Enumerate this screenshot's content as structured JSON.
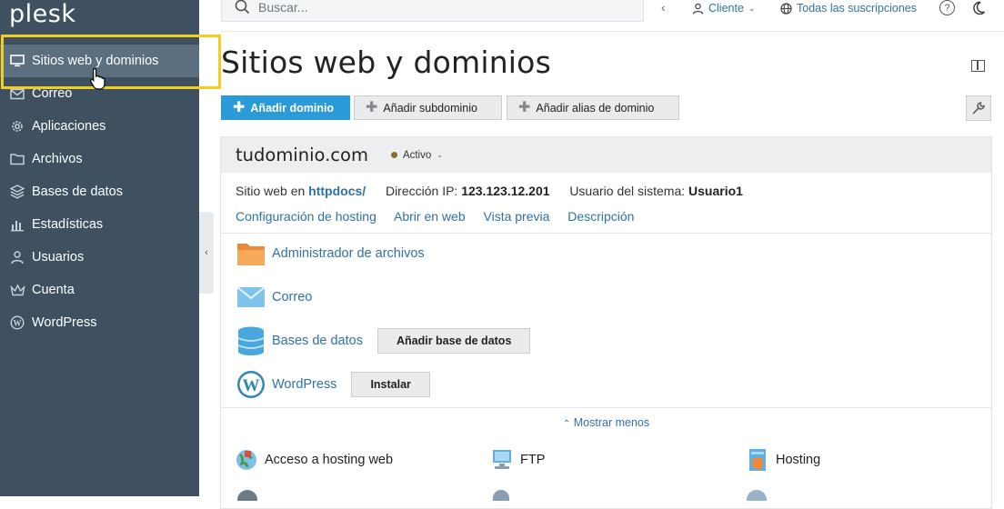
{
  "app": {
    "logo_text": "plesk"
  },
  "sidebar": {
    "items": [
      {
        "label": "Sitios web y dominios",
        "icon": "monitor-icon",
        "active": true
      },
      {
        "label": "Correo",
        "icon": "mail-icon"
      },
      {
        "label": "Aplicaciones",
        "icon": "gear-icon"
      },
      {
        "label": "Archivos",
        "icon": "folder-icon"
      },
      {
        "label": "Bases de datos",
        "icon": "database-icon"
      },
      {
        "label": "Estadísticas",
        "icon": "bar-chart-icon"
      },
      {
        "label": "Usuarios",
        "icon": "user-icon"
      },
      {
        "label": "Cuenta",
        "icon": "crown-icon"
      },
      {
        "label": "WordPress",
        "icon": "wordpress-icon"
      }
    ]
  },
  "topbar": {
    "search_placeholder": "Buscar...",
    "client_label": "Cliente",
    "subscriptions_label": "Todas las suscripciones",
    "help_glyph": "?"
  },
  "page": {
    "title": "Sitios web y dominios"
  },
  "toolbar": {
    "add_domain": "Añadir dominio",
    "add_subdomain": "Añadir subdominio",
    "add_alias": "Añadir alias de dominio"
  },
  "domain": {
    "name": "tudominio.com",
    "status": "Activo",
    "website_label": "Sitio web en",
    "website_path": "httpdocs/",
    "ip_label": "Dirección IP:",
    "ip_value": "123.123.12.201",
    "user_label": "Usuario del sistema:",
    "user_value": "Usuario1",
    "links": [
      "Configuración de hosting",
      "Abrir en web",
      "Vista previa",
      "Descripción"
    ],
    "tools": {
      "file_manager": "Administrador de archivos",
      "mail": "Correo",
      "databases": "Bases de datos",
      "add_database": "Añadir base de datos",
      "wordpress": "WordPress",
      "install": "Instalar"
    },
    "show_less": "Mostrar menos",
    "features": {
      "web_hosting_access": "Acceso a hosting web",
      "ftp": "FTP",
      "hosting": "Hosting"
    }
  },
  "colors": {
    "sidebar_bg": "#3f5161",
    "active_item_bg": "#5c6f7f",
    "accent": "#2b9ad9",
    "link": "#2f72a6",
    "highlight": "#f2cf1e"
  }
}
